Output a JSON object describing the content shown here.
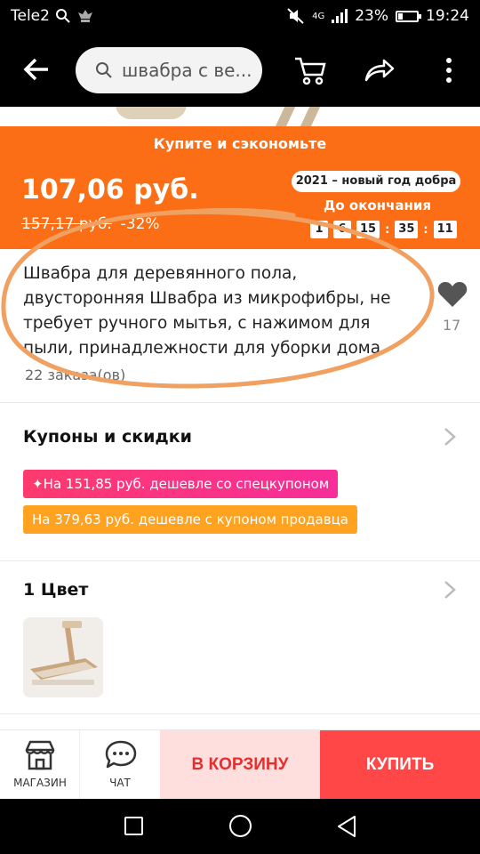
{
  "status_bar": {
    "carrier": "Tele2",
    "network": "4G",
    "battery": "23%",
    "time": "19:24"
  },
  "search": {
    "query": "швабра с ве..."
  },
  "promo": {
    "title": "Купите и сэкономьте",
    "price": "107,06 руб.",
    "old_price": "157,17 руб.",
    "discount": "-32%",
    "badge": "2021 – новый год добра",
    "until_label": "До окончания",
    "timer": [
      "1",
      "6",
      "15",
      "35",
      "11"
    ]
  },
  "product": {
    "title": "Швабра для деревянного пола, двусторонняя Швабра из микрофибры, не требует ручного мытья, с нажимом для пыли, принадлежности для уборки дома",
    "favorites": "17",
    "orders": "22 заказа(ов)"
  },
  "coupons": {
    "title": "Купоны и скидки",
    "special": "✦На 151,85 руб. дешевле со спецкупоном",
    "seller": "На 379,63 руб. дешевле с купоном продавца"
  },
  "color_section": {
    "title": "1 Цвет"
  },
  "bottom": {
    "store": "МАГАЗИН",
    "chat": "ЧАТ",
    "cart": "В КОРЗИНУ",
    "buy": "КУПИТЬ"
  },
  "colors": {
    "accent": "#fb6e16",
    "buy": "#ff4747",
    "cart_bg": "#ffdede",
    "annotation": "#f0a060"
  }
}
